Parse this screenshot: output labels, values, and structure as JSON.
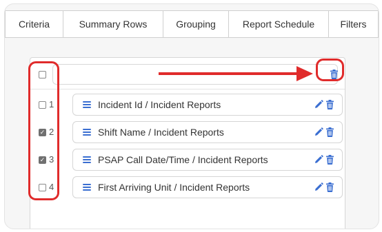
{
  "tabs": [
    {
      "label": "Criteria"
    },
    {
      "label": "Summary Rows"
    },
    {
      "label": "Grouping"
    },
    {
      "label": "Report Schedule"
    },
    {
      "label": "Filters"
    }
  ],
  "rows": [
    {
      "number": "1",
      "checked": false,
      "label": "Incident Id / Incident Reports"
    },
    {
      "number": "2",
      "checked": true,
      "label": "Shift Name / Incident Reports"
    },
    {
      "number": "3",
      "checked": true,
      "label": "PSAP Call Date/Time / Incident Reports"
    },
    {
      "number": "4",
      "checked": false,
      "label": "First Arriving Unit / Incident Reports"
    }
  ],
  "header_checkbox": {
    "checked": false
  },
  "colors": {
    "accent": "#3a6ed1",
    "annotation": "#e02b2b",
    "checkbox_checked": "#707070"
  },
  "icons": {
    "row_handle": "menu-icon",
    "edit": "pencil-icon",
    "delete": "trash-icon",
    "arrow": "arrow-right-icon"
  }
}
